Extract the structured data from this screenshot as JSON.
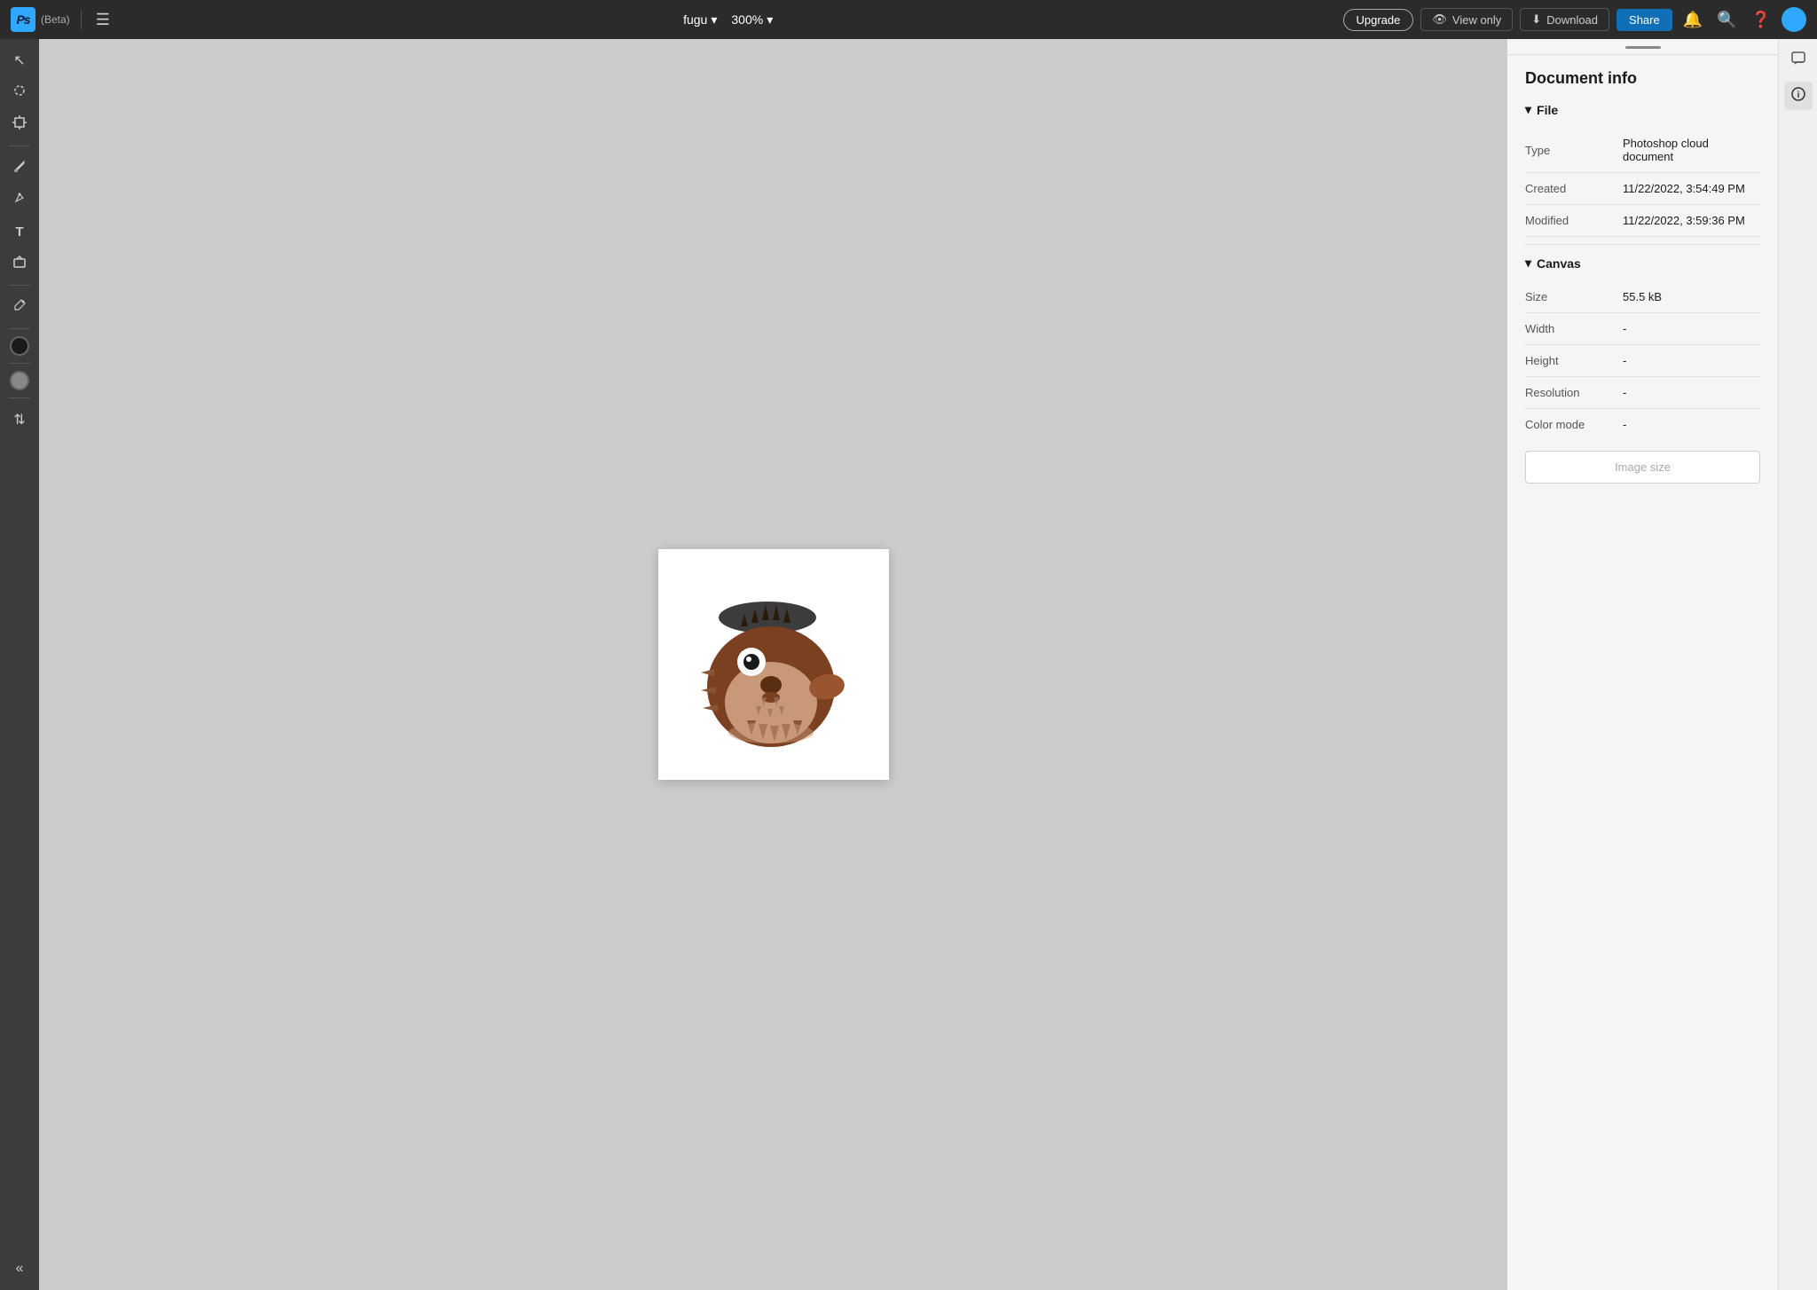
{
  "app": {
    "name": "Ps",
    "beta": "(Beta)"
  },
  "topbar": {
    "filename": "fugu",
    "zoom": "300%",
    "upgrade_label": "Upgrade",
    "view_only_label": "View only",
    "download_label": "Download",
    "share_label": "Share"
  },
  "toolbar": {
    "tools": [
      {
        "name": "select",
        "icon": "↖",
        "label": "Select"
      },
      {
        "name": "lasso",
        "icon": "◌",
        "label": "Lasso"
      },
      {
        "name": "transform",
        "icon": "⊕",
        "label": "Transform"
      },
      {
        "name": "brush",
        "icon": "✏",
        "label": "Brush"
      },
      {
        "name": "pen",
        "icon": "✒",
        "label": "Pen"
      },
      {
        "name": "text",
        "icon": "T",
        "label": "Text"
      },
      {
        "name": "shape",
        "icon": "❖",
        "label": "Shape"
      },
      {
        "name": "eyedropper",
        "icon": "⊘",
        "label": "Eyedropper"
      }
    ],
    "foreground_color": "#1a1a1a",
    "background_color": "#888888",
    "collapse_label": "«"
  },
  "panel": {
    "title": "Document info",
    "file_section": {
      "label": "File",
      "rows": [
        {
          "label": "Type",
          "value": "Photoshop cloud document"
        },
        {
          "label": "Created",
          "value": "11/22/2022, 3:54:49 PM"
        },
        {
          "label": "Modified",
          "value": "11/22/2022, 3:59:36 PM"
        }
      ]
    },
    "canvas_section": {
      "label": "Canvas",
      "rows": [
        {
          "label": "Size",
          "value": "55.5 kB"
        },
        {
          "label": "Width",
          "value": "-"
        },
        {
          "label": "Height",
          "value": "-"
        },
        {
          "label": "Resolution",
          "value": "-"
        },
        {
          "label": "Color mode",
          "value": "-"
        }
      ]
    },
    "image_size_button": "Image size"
  },
  "right_icons": [
    {
      "name": "comment",
      "icon": "💬"
    },
    {
      "name": "info",
      "icon": "ℹ"
    }
  ]
}
